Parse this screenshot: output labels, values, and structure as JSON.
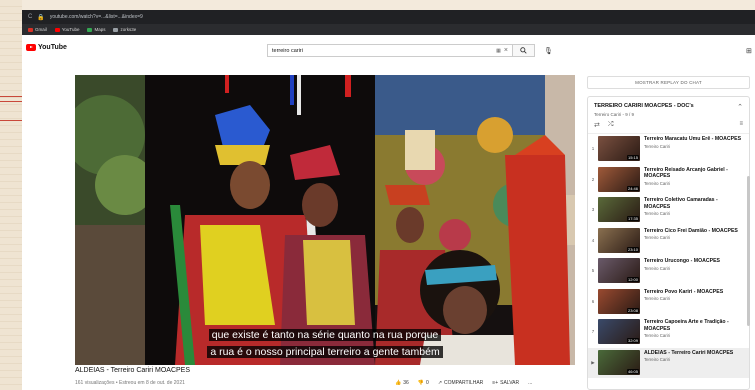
{
  "browser": {
    "url": "youtube.com/watch?v=...&list=...&index=9",
    "bookmarks": [
      {
        "label": "Gmail",
        "color": "#d93025"
      },
      {
        "label": "YouTube",
        "color": "#ff0000"
      },
      {
        "label": "Maps",
        "color": "#34a853"
      },
      {
        "label": "zorks3e",
        "color": "#9aa0a6"
      }
    ]
  },
  "header": {
    "logo_text": "YouTube",
    "search_query": "terreiro cariri"
  },
  "video": {
    "subtitle_line1": "que existe é tanto na série quanto na rua porque",
    "subtitle_line2": "a rua é o nosso principal terreiro a gente também",
    "title": "ALDEIAS - Terreiro Cariri MOACPES",
    "meta": "161 visualizações • Estreou em 8 de out. de 2021",
    "likes": "36",
    "dislikes": "0",
    "share_label": "COMPARTILHAR",
    "save_label": "SALVAR",
    "more_label": "..."
  },
  "chat_button": "MOSTRAR REPLAY DO CHAT",
  "playlist": {
    "title": "TERREIRO CARIRI MOACPES - DOC's",
    "subtitle": "Terreiro Cariri - 9 / 9",
    "items": [
      {
        "index": "1",
        "title": "Terreiro Maracatu Umu Erê - MOACPES",
        "channel": "Terreiro Cariri",
        "duration": "15:15",
        "color": "#7a5040"
      },
      {
        "index": "2",
        "title": "Terreiro Reisado Arcanjo Gabriel - MOACPES",
        "channel": "Terreiro Cariri",
        "duration": "24:46",
        "color": "#a05a3a"
      },
      {
        "index": "3",
        "title": "Terreiro Coletivo Camaradas - MOACPES",
        "channel": "Terreiro Cariri",
        "duration": "17:35",
        "color": "#5a6a3a"
      },
      {
        "index": "4",
        "title": "Terreiro Cico Frei Damião - MOACPES",
        "channel": "Terreiro Cariri",
        "duration": "23:10",
        "color": "#8a7050"
      },
      {
        "index": "5",
        "title": "Terreiro Urucongo - MOACPES",
        "channel": "Terreiro Cariri",
        "duration": "12:00",
        "color": "#6a5a6a"
      },
      {
        "index": "6",
        "title": "Terreiro Povo Kariri - MOACPES",
        "channel": "Terreiro Cariri",
        "duration": "23:08",
        "color": "#9a4a30"
      },
      {
        "index": "7",
        "title": "Terreiro Capoeira Arte e Tradição - MOACPES",
        "channel": "Terreiro Cariri",
        "duration": "32:09",
        "color": "#3a4a6a"
      },
      {
        "index": "▶",
        "title": "ALDEIAS - Terreiro Cariri MOACPES",
        "channel": "Terreiro Cariri",
        "duration": "46:05",
        "color": "#4a6a3a",
        "active": true
      }
    ]
  }
}
